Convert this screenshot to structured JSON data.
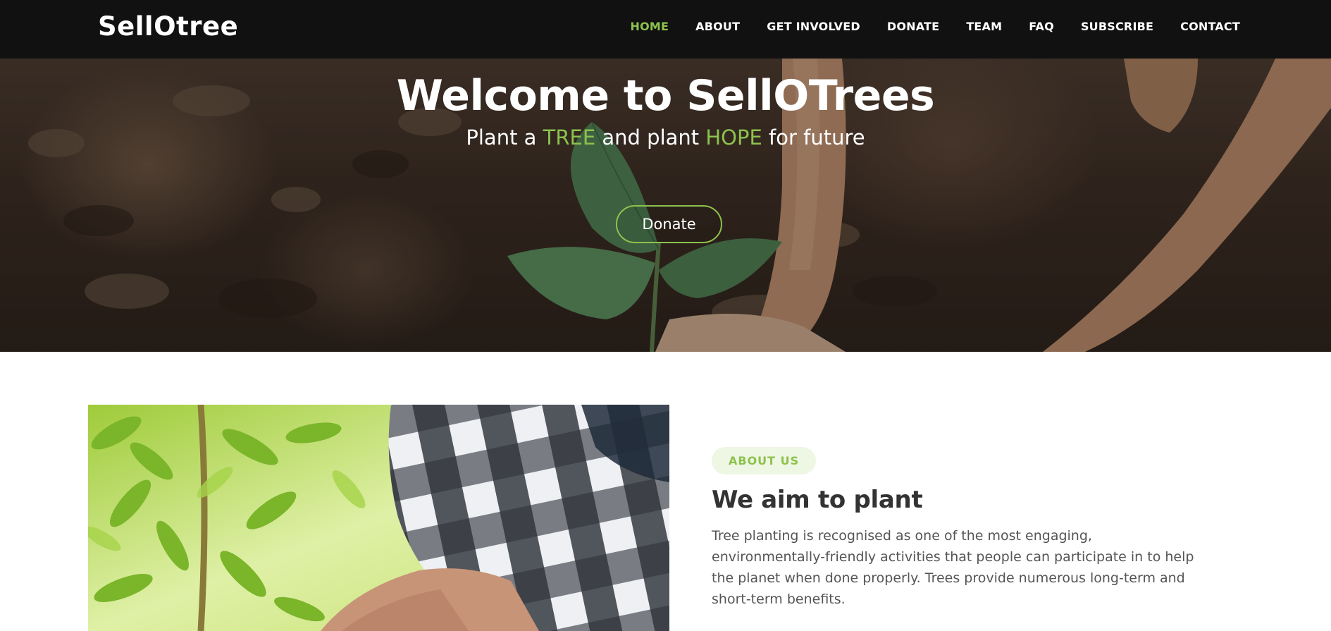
{
  "brand": "SellOtree",
  "nav": {
    "items": [
      {
        "label": "HOME",
        "active": true
      },
      {
        "label": "ABOUT"
      },
      {
        "label": "GET INVOLVED"
      },
      {
        "label": "DONATE"
      },
      {
        "label": "TEAM"
      },
      {
        "label": "FAQ"
      },
      {
        "label": "SUBSCRIBE"
      },
      {
        "label": "CONTACT"
      }
    ]
  },
  "hero": {
    "title": "Welcome to SellOTrees",
    "subtitle_parts": [
      "Plant a ",
      "TREE",
      " and plant ",
      "HOPE",
      " for future"
    ],
    "button_label": "Donate"
  },
  "about": {
    "badge": "ABOUT US",
    "heading": "We aim to plant",
    "body": "Tree planting is recognised as one of the most engaging, environmentally-friendly activities that people can participate in to help the planet when done properly. Trees provide numerous long-term and short-term benefits."
  },
  "colors": {
    "accent": "#8dc24c",
    "navbar_bg": "#111111",
    "heading": "#333333",
    "body_text": "#555555",
    "badge_bg": "#eef6e4"
  }
}
